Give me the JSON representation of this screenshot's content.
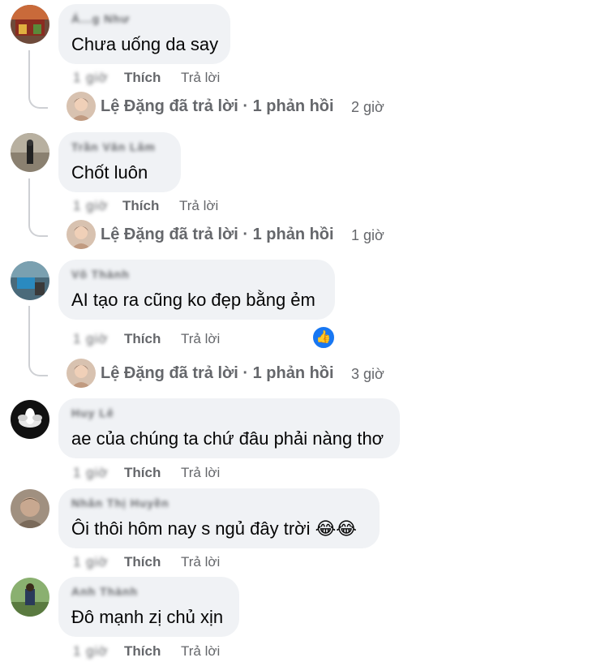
{
  "comments": [
    {
      "author": "Á...g Như",
      "text": "Chưa uống da say",
      "time": "1 giờ",
      "like": "Thích",
      "reply": "Trả lời",
      "reply_summary": {
        "name": "Lệ Đặng đã trả lời · 1 phản hồi",
        "time": "2 giờ"
      }
    },
    {
      "author": "Trần Văn Lâm",
      "text": "Chốt luôn",
      "time": "1 giờ",
      "like": "Thích",
      "reply": "Trả lời",
      "reply_summary": {
        "name": "Lệ Đặng đã trả lời · 1 phản hồi",
        "time": "1 giờ"
      }
    },
    {
      "author": "Võ Thành",
      "text": "AI tạo ra cũng ko đẹp bằng ẻm",
      "time": "1 giờ",
      "like": "Thích",
      "reply": "Trả lời",
      "reaction": "like-reaction-icon",
      "reply_summary": {
        "name": "Lệ Đặng đã trả lời · 1 phản hồi",
        "time": "3 giờ"
      }
    },
    {
      "author": "Huy Lê",
      "text": "ae của chúng ta chứ đâu phải nàng thơ",
      "time": "1 giờ",
      "like": "Thích",
      "reply": "Trả lời"
    },
    {
      "author": "Nhân Thị Huyền",
      "text": "Ôi thôi hôm nay s ngủ đây trời",
      "emoji": "😂😂",
      "time": "1 giờ",
      "like": "Thích",
      "reply": "Trả lời"
    },
    {
      "author": "Anh Thành",
      "text": "Đô mạnh zị chủ xịn",
      "time": "1 giờ",
      "like": "Thích",
      "reply": "Trả lời"
    }
  ],
  "colors": {
    "bubble": "#f0f2f5",
    "secondary_text": "#65676b",
    "like_blue": "#1877f2"
  }
}
